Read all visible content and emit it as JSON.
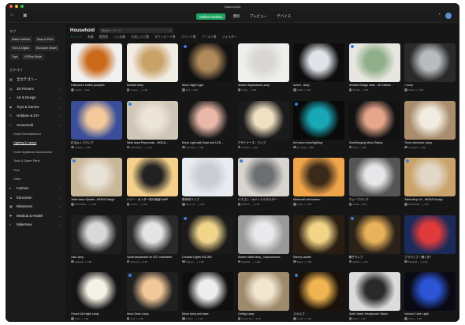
{
  "window": {
    "title": "Makerworld"
  },
  "topnav": {
    "tabs": [
      {
        "label": "Online Models",
        "active": true
      },
      {
        "label": "資料",
        "active": false
      },
      {
        "label": "プレビュー",
        "active": false
      },
      {
        "label": "デバイス",
        "active": false
      }
    ]
  },
  "sidebar": {
    "tags_heading": "タグ",
    "tags": [
      "Maker Verified",
      "Easy to Print",
      "Tech & Digital",
      "Exclusive Model",
      "Toys",
      "K2Plus Mode"
    ],
    "categories_heading": "カテゴリ",
    "categories": [
      {
        "label": "全カテゴリー",
        "icon": "grid-icon",
        "level": 0
      },
      {
        "label": "3D Printers",
        "icon": "printer-icon",
        "level": 0
      },
      {
        "label": "Art & Design",
        "icon": "palette-icon",
        "level": 0
      },
      {
        "label": "Toys & Games",
        "icon": "game-icon",
        "level": 0
      },
      {
        "label": "Hobbies & DIY",
        "icon": "tool-icon",
        "level": 0
      },
      {
        "label": "Household",
        "icon": "home-icon",
        "level": 0
      },
      {
        "label": "Home Decorations &",
        "level": 1
      },
      {
        "label": "Lighting & Lamps",
        "level": 1,
        "selected": true
      },
      {
        "label": "Home Appliance Accessories",
        "level": 1
      },
      {
        "label": "Tools & Spare Parts",
        "level": 1
      },
      {
        "label": "Pets",
        "level": 1
      },
      {
        "label": "Other",
        "level": 1
      },
      {
        "label": "Fashion",
        "icon": "shirt-icon",
        "level": 0
      },
      {
        "label": "Education",
        "icon": "cap-icon",
        "level": 0
      },
      {
        "label": "Miniatures",
        "icon": "cube-icon",
        "level": 0
      },
      {
        "label": "Medical & Health",
        "icon": "cross-icon",
        "level": 0
      },
      {
        "label": "MakeNow",
        "icon": "bolt-icon",
        "level": 0
      }
    ]
  },
  "main": {
    "title": "Household",
    "search_placeholder": "検索キーワード",
    "filters": [
      {
        "label": "トレンド",
        "on": true
      },
      {
        "label": "新着",
        "on": false
      },
      {
        "label": "閲覧数",
        "on": false
      },
      {
        "label": "いいね数",
        "on": false
      },
      {
        "label": "お気に入り数",
        "on": false
      },
      {
        "label": "ダウンロード数",
        "on": false
      },
      {
        "label": "プリント数",
        "on": false
      },
      {
        "label": "ブースト数",
        "on": false
      },
      {
        "label": "フォルダー",
        "on": false
      }
    ],
    "cards": [
      {
        "title": "Halloween hollow pumpkin",
        "user": "nas62",
        "stats": "1.5K",
        "colors": [
          "#cc6a1c",
          "#f0f0f0"
        ]
      },
      {
        "title": "Bedside lamp",
        "user": "Create...",
        "stats": "1.1K",
        "colors": [
          "#c9a26a",
          "#f1ece4"
        ]
      },
      {
        "title": "Moon Night Light",
        "user": "Rdf",
        "stats": "1.6K",
        "colors": [
          "#b08a5a",
          "#111"
        ]
      },
      {
        "title": "Modern Nightstand Lamp",
        "user": "Nedg...",
        "stats": "921",
        "colors": [
          "#d9d7d3",
          "#eeeeec"
        ]
      },
      {
        "title": "lucent - lamp",
        "user": "Hs28",
        "stats": "1.1K",
        "colors": [
          "#dfe2e8",
          "#0d0d0d"
        ]
      },
      {
        "title": "Verdant Ginkgo Vase - 3D Nature...",
        "user": "Printan",
        "stats": "1.6K",
        "colors": [
          "#8fb08a",
          "#e8e6e0"
        ]
      },
      {
        "title": "« lamp",
        "user": "Prides",
        "stats": "1.0K",
        "colors": [
          "#b9bcbf",
          "#2a2a2a"
        ]
      },
      {
        "title": "灯るキノコランプ",
        "user": "chikara",
        "stats": "3.6K",
        "colors": [
          "#f3c89a",
          "#3a4e9a"
        ]
      },
      {
        "title": "Table lamp Peperomia - MOKA...",
        "user": "MOKADes...",
        "stats": "1.4K",
        "colors": [
          "#ede6d8",
          "#cfc6b7"
        ]
      },
      {
        "title": "Moon Light with Base and LED...",
        "user": "ViperFile",
        "stats": "1.8K",
        "colors": [
          "#e9b8a8",
          "#161616"
        ]
      },
      {
        "title": "デザイナーズ・ランプ",
        "user": "Cali.Mo",
        "stats": "1.3K",
        "colors": [
          "#efe0c2",
          "#1b1b1b"
        ]
      },
      {
        "title": "full moon mood lighting",
        "user": "Dr. Dugu",
        "stats": "818",
        "colors": [
          "#19a8b6",
          "#0a0a0a"
        ]
      },
      {
        "title": "DeskHanging Moon Stamp",
        "user": "flmdt",
        "stats": "1.2K",
        "colors": [
          "#e6a68c",
          "#121212"
        ]
      },
      {
        "title": "Three elements Lamp",
        "user": "Jonas30",
        "stats": "1.5K",
        "colors": [
          "#f2ece0",
          "#a98d6d"
        ]
      },
      {
        "title": "Table lamp Spirala - MOKA Design",
        "user": "MOKADes...",
        "stats": "1.2K",
        "colors": [
          "#e8e2d6",
          "#c9b79a"
        ]
      },
      {
        "title": "ハリー・ポッター死の秘宝LAMP",
        "user": "Lumin...",
        "stats": "2.1K",
        "colors": [
          "#222",
          "#f4d08a"
        ]
      },
      {
        "title": "熱気球ランプ",
        "user": "Sony_S...",
        "stats": "1.1K",
        "colors": [
          "#c8cdd3",
          "#e8ebef"
        ]
      },
      {
        "title": "ドラゴン・キャンドルホルダー",
        "user": "PAMYA...",
        "stats": "1.2K",
        "colors": [
          "#6d6f72",
          "#d8d4cf"
        ]
      },
      {
        "title": "Minecraft mini lantern",
        "user": "Imyer",
        "stats": "1.2K",
        "colors": [
          "#3b2a1a",
          "#f0a54a"
        ]
      },
      {
        "title": "ウェーブランプ",
        "user": "kobiko",
        "stats": "917",
        "colors": [
          "#e7e7e9",
          "#555"
        ]
      },
      {
        "title": "Table lamp UL - MOKA Design",
        "user": "MOKADes...",
        "stats": "871",
        "colors": [
          "#e2d7c6",
          "#c9a36a"
        ]
      },
      {
        "title": "Owl Lamp",
        "user": "Gallocat",
        "stats": "1.5K",
        "colors": [
          "#d8d8da",
          "#1e1e1e"
        ]
      },
      {
        "title": "Spiral lampshade for E27 chandelier",
        "user": "Salmers",
        "stats": "2.1K",
        "colors": [
          "#e4e4e4",
          "#2a2a2a"
        ]
      },
      {
        "title": "Creative Lights RG-009",
        "user": "Suguru...",
        "stats": "1.0K",
        "colors": [
          "#f0d48a",
          "#1a1a1a"
        ]
      },
      {
        "title": "Modern table lamp_ Nowoczesna...",
        "user": "DanielO...",
        "stats": "1.2K",
        "colors": [
          "#e9e9eb",
          "#9a9a9a"
        ]
      },
      {
        "title": "Disney candle",
        "user": "Rasrc",
        "stats": "1.3K",
        "colors": [
          "#f2d486",
          "#2a1e12"
        ]
      },
      {
        "title": "棚子ランプ",
        "user": "kobika",
        "stats": "1.1K",
        "colors": [
          "#e8b25a",
          "#2a2118"
        ]
      },
      {
        "title": "プラランプ・線く光 !",
        "user": "PlasticM...",
        "stats": "2.4K",
        "colors": [
          "#e23a3a",
          "#1c2a5a"
        ]
      },
      {
        "title": "Ghost Cat Night Lamp",
        "user": "DYoJ",
        "stats": "1.6K",
        "colors": [
          "#f6f1e6",
          "#141414"
        ]
      },
      {
        "title": "Moon Desk Lamp",
        "user": "JuSi",
        "stats": "1.3K",
        "colors": [
          "#f2c89a",
          "#202020"
        ]
      },
      {
        "title": "Moon lamp and base",
        "user": "Tytkvo...",
        "stats": "1.1K",
        "colors": [
          "#ededed",
          "#0f0f0f"
        ]
      },
      {
        "title": "Ceiling Lamp",
        "user": "Persis Tec",
        "stats": "2.3K",
        "colors": [
          "#f3e6d0",
          "#9e8b6e"
        ]
      },
      {
        "title": "スカルプ",
        "user": "Lordd",
        "stats": "1.2K",
        "colors": [
          "#f0b450",
          "#1a120a"
        ]
      },
      {
        "title": "Darth Vader Headphone Stand",
        "user": "Brelt",
        "stats": "1.3K",
        "colors": [
          "#2a2a2a",
          "#dcdcdc"
        ]
      },
      {
        "title": "Voronoi Cube Light",
        "user": "Tauri",
        "stats": "1.1K",
        "colors": [
          "#2b54d6",
          "#0a0a14"
        ]
      }
    ]
  }
}
